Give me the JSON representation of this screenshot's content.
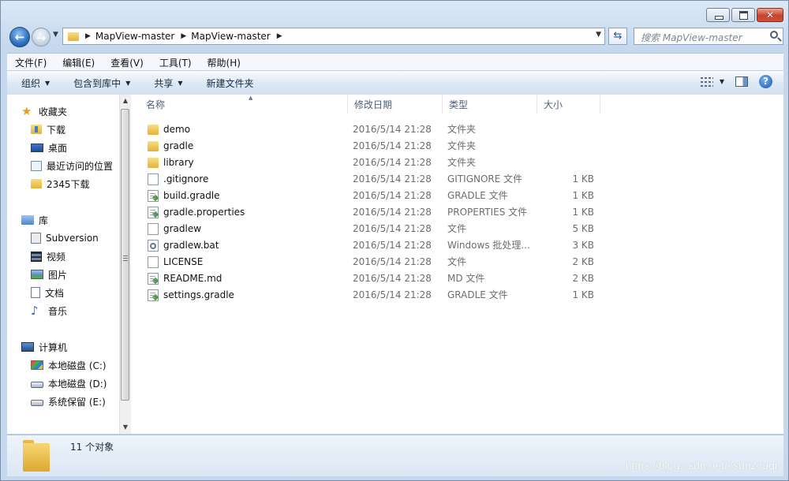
{
  "window": {
    "caption_close_glyph": "✕"
  },
  "address": {
    "crumbs": [
      "MapView-master",
      "MapView-master"
    ],
    "search_placeholder": "搜索 MapView-master"
  },
  "menu": [
    "文件(F)",
    "编辑(E)",
    "查看(V)",
    "工具(T)",
    "帮助(H)"
  ],
  "commands": [
    {
      "label": "组织",
      "dropdown": true
    },
    {
      "label": "包含到库中",
      "dropdown": true
    },
    {
      "label": "共享",
      "dropdown": true
    },
    {
      "label": "新建文件夹",
      "dropdown": false
    }
  ],
  "nav": {
    "favorites": {
      "label": "收藏夹",
      "items": [
        "下载",
        "桌面",
        "最近访问的位置",
        "2345下载"
      ]
    },
    "libraries": {
      "label": "库",
      "items": [
        "Subversion",
        "视频",
        "图片",
        "文档",
        "音乐"
      ]
    },
    "computer": {
      "label": "计算机",
      "items": [
        "本地磁盘 (C:)",
        "本地磁盘 (D:)",
        "系统保留 (E:)"
      ]
    }
  },
  "columns": {
    "name": "名称",
    "date": "修改日期",
    "type": "类型",
    "size": "大小"
  },
  "files": [
    {
      "icon": "folder",
      "name": "demo",
      "date": "2016/5/14 21:28",
      "type": "文件夹",
      "size": ""
    },
    {
      "icon": "folder",
      "name": "gradle",
      "date": "2016/5/14 21:28",
      "type": "文件夹",
      "size": ""
    },
    {
      "icon": "folder",
      "name": "library",
      "date": "2016/5/14 21:28",
      "type": "文件夹",
      "size": ""
    },
    {
      "icon": "file",
      "name": ".gitignore",
      "date": "2016/5/14 21:28",
      "type": "GITIGNORE 文件",
      "size": "1 KB"
    },
    {
      "icon": "doc",
      "name": "build.gradle",
      "date": "2016/5/14 21:28",
      "type": "GRADLE 文件",
      "size": "1 KB"
    },
    {
      "icon": "doc",
      "name": "gradle.properties",
      "date": "2016/5/14 21:28",
      "type": "PROPERTIES 文件",
      "size": "1 KB"
    },
    {
      "icon": "file",
      "name": "gradlew",
      "date": "2016/5/14 21:28",
      "type": "文件",
      "size": "5 KB"
    },
    {
      "icon": "bat",
      "name": "gradlew.bat",
      "date": "2016/5/14 21:28",
      "type": "Windows 批处理...",
      "size": "3 KB"
    },
    {
      "icon": "file",
      "name": "LICENSE",
      "date": "2016/5/14 21:28",
      "type": "文件",
      "size": "2 KB"
    },
    {
      "icon": "doc",
      "name": "README.md",
      "date": "2016/5/14 21:28",
      "type": "MD 文件",
      "size": "2 KB"
    },
    {
      "icon": "doc",
      "name": "settings.gradle",
      "date": "2016/5/14 21:28",
      "type": "GRADLE 文件",
      "size": "1 KB"
    }
  ],
  "status": {
    "text": "11 个对象"
  },
  "watermark": "https://blog.csdn.net/csdnzouqi"
}
